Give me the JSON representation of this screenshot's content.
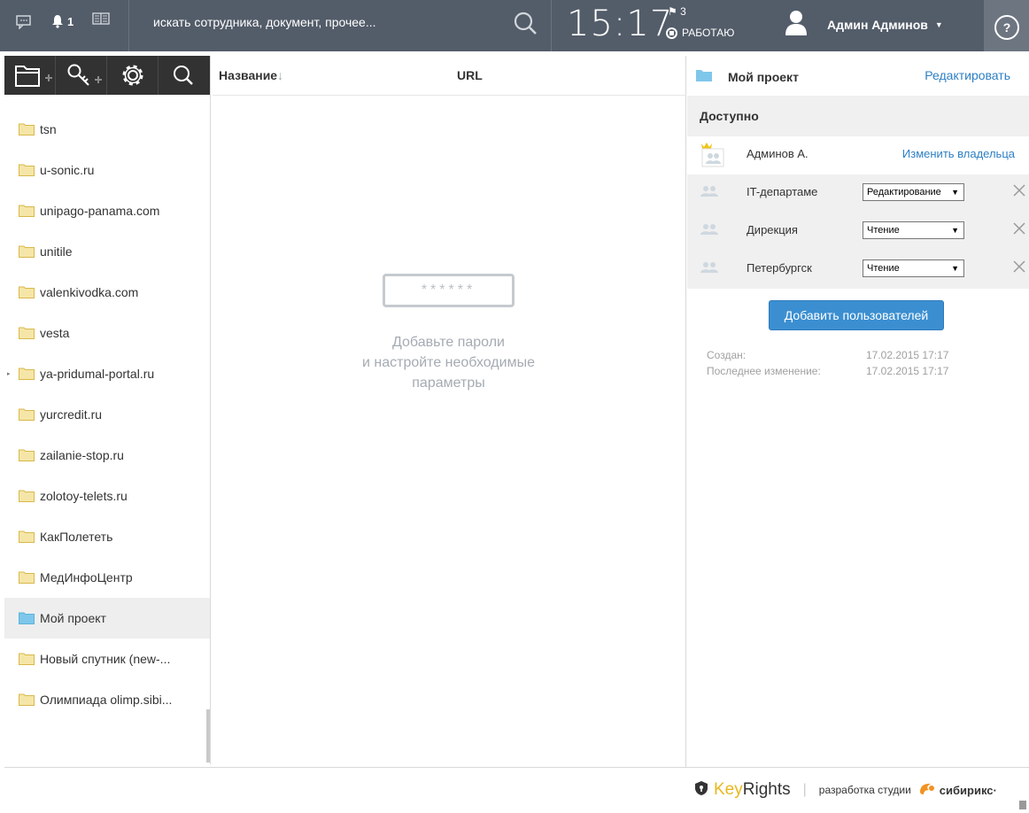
{
  "topbar": {
    "notifications_count": "1",
    "search_placeholder": "искать сотрудника, документ, прочее...",
    "clock": "15:17",
    "flag_count": "3",
    "status": "РАБОТАЮ",
    "user_name": "Админ Админов",
    "help": "?"
  },
  "tree": {
    "items": [
      {
        "label": "tsn"
      },
      {
        "label": "u-sonic.ru"
      },
      {
        "label": "unipago-panama.com"
      },
      {
        "label": "unitile"
      },
      {
        "label": "valenkivodka.com"
      },
      {
        "label": "vesta"
      },
      {
        "label": "ya-pridumal-portal.ru"
      },
      {
        "label": "yurcredit.ru"
      },
      {
        "label": "zailanie-stop.ru"
      },
      {
        "label": "zolotoy-telets.ru"
      },
      {
        "label": "КакПолететь"
      },
      {
        "label": "МедИнфоЦентр"
      },
      {
        "label": "Мой проект"
      },
      {
        "label": "Новый спутник (new-..."
      },
      {
        "label": "Олимпиада olimp.sibi..."
      }
    ]
  },
  "table": {
    "col_name": "Название",
    "col_sort": "↓",
    "col_url": "URL",
    "empty_password": "******",
    "empty_line1": "Добавьте пароли",
    "empty_line2": "и настройте необходимые",
    "empty_line3": "параметры"
  },
  "panel": {
    "title": "Мой проект",
    "edit": "Редактировать",
    "available": "Доступно",
    "owner_name": "Админов А.",
    "change_owner": "Изменить владельца",
    "rows": [
      {
        "name": "IT-департаме",
        "access": "Редактирование"
      },
      {
        "name": "Дирекция",
        "access": "Чтение"
      },
      {
        "name": "Петербургск",
        "access": "Чтение"
      }
    ],
    "add_users": "Добавить пользователей",
    "created_label": "Создан:",
    "created_value": "17.02.2015 17:17",
    "modified_label": "Последнее изменение:",
    "modified_value": "17.02.2015 17:17"
  },
  "footer": {
    "brand_key": "Key",
    "brand_rights": "Rights",
    "sep": "|",
    "dev": "разработка студии",
    "studio": "сибирикс·"
  },
  "colors": {
    "topbar": "#535c69",
    "accent": "#3b8fd1",
    "link": "#2d7fc3",
    "folder": "#f5e6a8",
    "folder_active": "#7ec7ea"
  }
}
